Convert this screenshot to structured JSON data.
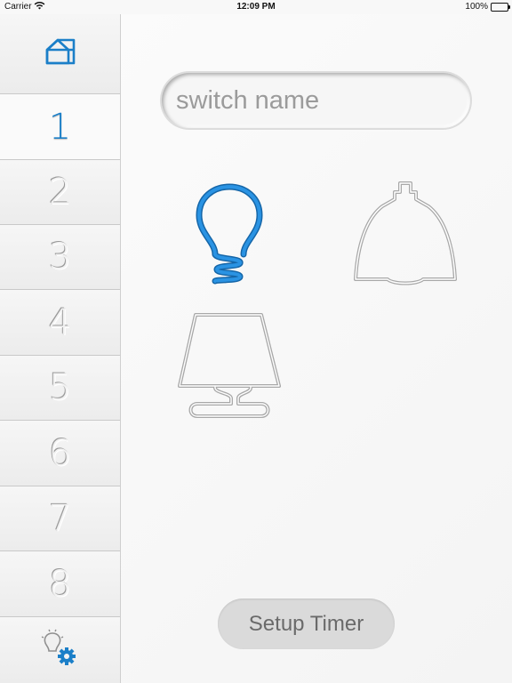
{
  "status_bar": {
    "carrier": "Carrier",
    "time": "12:09 PM",
    "battery": "100%"
  },
  "sidebar": {
    "items": [
      {
        "type": "home",
        "icon": "home-icon"
      },
      {
        "label": "1",
        "active": true
      },
      {
        "label": "2"
      },
      {
        "label": "3"
      },
      {
        "label": "4"
      },
      {
        "label": "5"
      },
      {
        "label": "6"
      },
      {
        "label": "7"
      },
      {
        "label": "8"
      },
      {
        "type": "settings",
        "icon": "settings-gear-icon"
      }
    ]
  },
  "main": {
    "switch_name_placeholder": "switch name",
    "lamps": [
      {
        "icon": "light-bulb-icon",
        "active": true
      },
      {
        "icon": "pendant-lamp-icon",
        "active": false
      },
      {
        "icon": "table-lamp-icon",
        "active": false
      }
    ],
    "setup_timer_label": "Setup Timer"
  },
  "colors": {
    "accent": "#1b7fc8",
    "background": "#f7f7f7",
    "timer_button": "#dadada"
  }
}
